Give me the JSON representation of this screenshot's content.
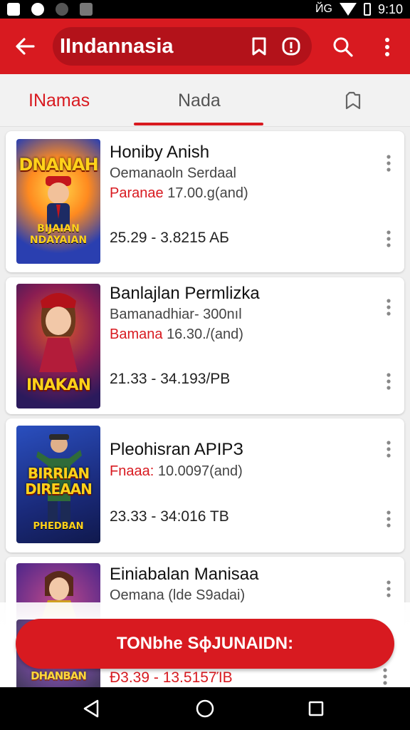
{
  "status_bar": {
    "left_icons": [
      "notification-icon",
      "chrome-icon",
      "record-icon",
      "gallery-icon"
    ],
    "network": "ЙG",
    "time": "9:10"
  },
  "app_bar": {
    "title": "IIndannasia"
  },
  "tabs": [
    {
      "label": "INamas",
      "active": false
    },
    {
      "label": "Nada",
      "active": true
    },
    {
      "label": "",
      "icon": "bookmark-add-icon"
    }
  ],
  "items": [
    {
      "title": "Honiby Anish",
      "subtitle": "Oemanaoln Serdaal",
      "price_label": "Paranae",
      "price_value": "17.00.g(and)",
      "range": "25.29 - 3.8215 AБ",
      "cover_title": "DNANAH",
      "cover_sub": "BIJAIAN\nNDAYAIAN"
    },
    {
      "title": "Banlajlan Permlizka",
      "subtitle": "Bamanadhiar- 300nıl",
      "price_label": "Bamana",
      "price_value": "16.30./(and)",
      "range": "21.33 - 34.193/PB",
      "cover_title": "INAKAN",
      "cover_sub": ""
    },
    {
      "title": "Pleohisran APIPЗ",
      "subtitle": "",
      "price_label": "Fnaaa:",
      "price_value": "10.0097(and)",
      "range": "23.33 - 34:016 TB",
      "cover_title": "BIRRIAN DIREAAN",
      "cover_sub": "PHEDBAN"
    },
    {
      "title": "Einiabalan Manisaa",
      "subtitle": "Oemana (lde S9adai)",
      "price_label": "",
      "price_value": "",
      "range": "Ð3.39 - 13.5157ΊB",
      "cover_title": "DHANBAN",
      "cover_sub": ""
    }
  ],
  "cta": {
    "label": "TONbhe ЅϕЈUNAIDN:"
  },
  "colors": {
    "accent": "#d81a20",
    "accent_dark": "#b3121a"
  }
}
